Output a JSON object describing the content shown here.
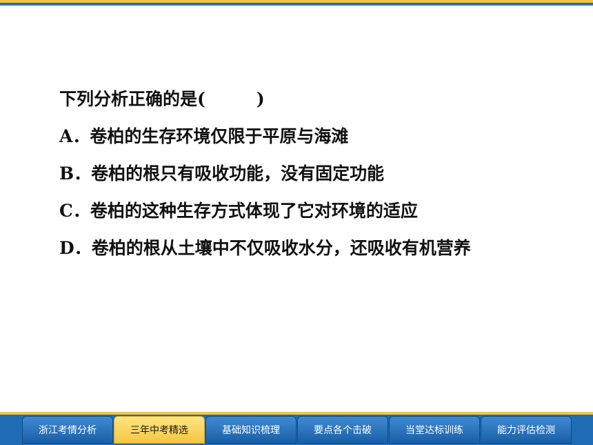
{
  "question": {
    "stem": "下列分析正确的是(",
    "stem_end": ")",
    "options": [
      {
        "label": "A．",
        "text": "卷柏的生存环境仅限于平原与海滩"
      },
      {
        "label": "B．",
        "text": "卷柏的根只有吸收功能，没有固定功能"
      },
      {
        "label": "C．",
        "text": "卷柏的这种生存方式体现了它对环境的适应"
      },
      {
        "label": "D．",
        "text": "卷柏的根从土壤中不仅吸收水分，还吸收有机营养"
      }
    ]
  },
  "nav": {
    "active_index": 1,
    "tabs": [
      "浙江考情分析",
      "三年中考精选",
      "基础知识梳理",
      "要点各个击破",
      "当堂达标训练",
      "能力评估检测"
    ]
  },
  "colors": {
    "accent_yellow": "#f4c542",
    "nav_blue": "#1f6cb5"
  }
}
